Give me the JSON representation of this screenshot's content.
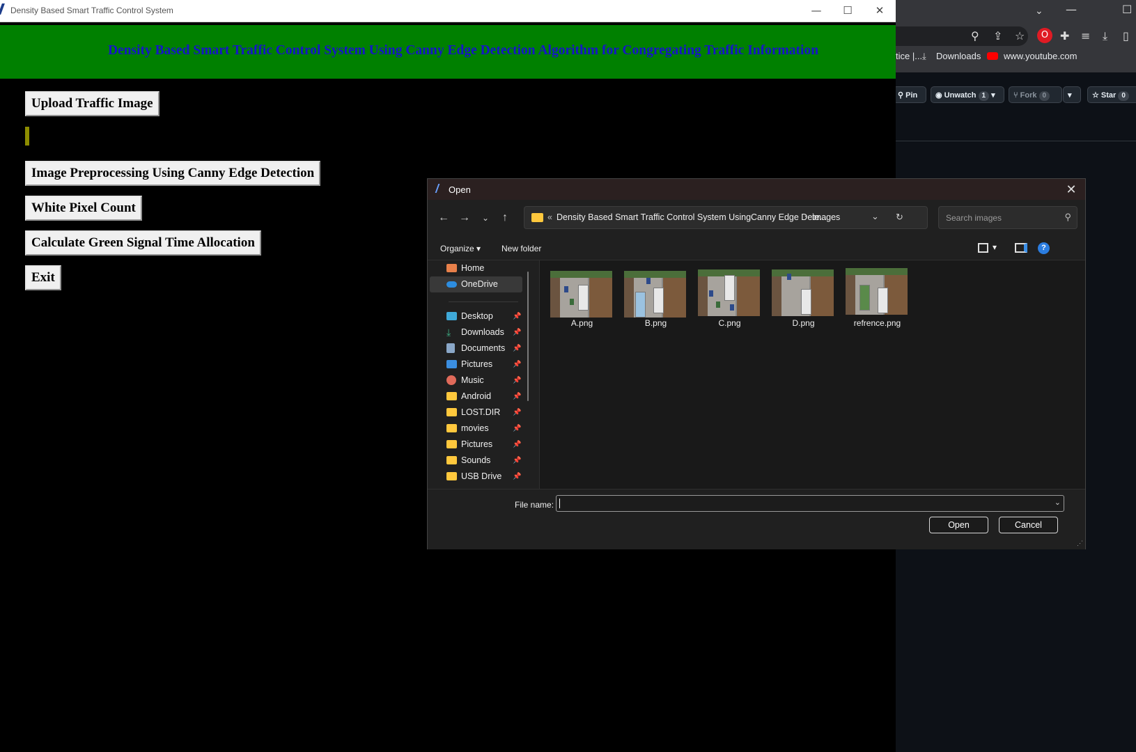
{
  "app": {
    "window_title": "Density Based Smart Traffic Control System",
    "heading": "Density Based Smart Traffic Control System Using Canny Edge Detection Algorithm for Congregating Traffic Information",
    "buttons": {
      "upload": "Upload Traffic Image",
      "preprocess": "Image Preprocessing Using Canny Edge Detection",
      "white_pixel": "White Pixel Count",
      "green_signal": "Calculate Green Signal Time Allocation",
      "exit": "Exit"
    },
    "window_controls": {
      "minimize": "—",
      "maximize": "☐",
      "close": "✕"
    },
    "colors": {
      "banner": "#008000",
      "heading_text": "#1515c8",
      "background": "#000000",
      "path_label": "#8c8c00"
    }
  },
  "browser": {
    "bookmarks": {
      "cut_off": "tice |...",
      "downloads": "Downloads",
      "youtube": "www.youtube.com"
    },
    "github": {
      "pin": "Pin",
      "unwatch": "Unwatch",
      "unwatch_count": "1",
      "fork": "Fork",
      "fork_count": "0",
      "star": "Star",
      "star_count": "0"
    }
  },
  "dialog": {
    "title": "Open",
    "address": {
      "prefix": "«",
      "folder_path": "Density Based Smart Traffic Control System UsingCanny Edge Dete...",
      "separator": "›",
      "current": "images"
    },
    "search_placeholder": "Search images",
    "commands": {
      "organize": "Organize",
      "new_folder": "New folder"
    },
    "nav_items": [
      {
        "label": "Home",
        "icon": "home-icon",
        "pinned": false
      },
      {
        "label": "OneDrive",
        "icon": "cloud-icon",
        "pinned": false,
        "selected": true
      },
      {
        "label": "Desktop",
        "icon": "desktop-icon",
        "pinned": true
      },
      {
        "label": "Downloads",
        "icon": "download-icon",
        "pinned": true
      },
      {
        "label": "Documents",
        "icon": "document-icon",
        "pinned": true
      },
      {
        "label": "Pictures",
        "icon": "pictures-icon",
        "pinned": true
      },
      {
        "label": "Music",
        "icon": "music-icon",
        "pinned": true
      },
      {
        "label": "Android",
        "icon": "folder-icon",
        "pinned": true
      },
      {
        "label": "LOST.DIR",
        "icon": "folder-icon",
        "pinned": true
      },
      {
        "label": "movies",
        "icon": "folder-icon",
        "pinned": true
      },
      {
        "label": "Pictures",
        "icon": "folder-icon",
        "pinned": true
      },
      {
        "label": "Sounds",
        "icon": "folder-icon",
        "pinned": true
      },
      {
        "label": "USB Drive",
        "icon": "folder-icon",
        "pinned": true
      }
    ],
    "files": [
      {
        "name": "A.png"
      },
      {
        "name": "B.png"
      },
      {
        "name": "C.png"
      },
      {
        "name": "D.png"
      },
      {
        "name": "refrence.png"
      }
    ],
    "file_name_label": "File name:",
    "file_name_value": "",
    "open_button": "Open",
    "cancel_button": "Cancel"
  }
}
